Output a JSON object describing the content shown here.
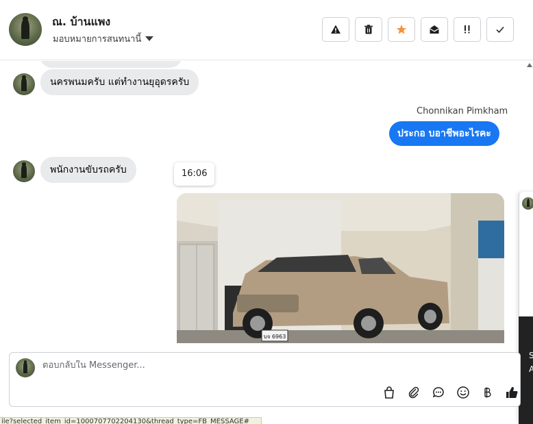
{
  "header": {
    "contact_name": "ณ. บ้านแพง",
    "assign_label": "มอบหมายการสนทนานี้",
    "accent_color": "#f7923a",
    "toolbar": [
      {
        "name": "report-spam-button",
        "icon": "warning-icon"
      },
      {
        "name": "delete-button",
        "icon": "trash-icon"
      },
      {
        "name": "star-button",
        "icon": "star-icon"
      },
      {
        "name": "mark-unread-button",
        "icon": "envelope-open-icon"
      },
      {
        "name": "follow-up-button",
        "icon": "exclaim-icon"
      },
      {
        "name": "mark-done-button",
        "icon": "check-icon"
      }
    ]
  },
  "thread": {
    "msg_1": "นครพนมครับ แต่ทำงานยุอุดรครับ",
    "agent_name": "Chonnikan Pimkham",
    "msg_2": "ประกอ บอาชีพอะไรคะ",
    "msg_3": "พนักงานขับรถครับ",
    "timestamp": "16:06",
    "photo": {
      "plate": "บจ 6963",
      "description": "pickup-truck-photo"
    }
  },
  "composer": {
    "placeholder": "ตอบกลับใน Messenger...",
    "icons": [
      "shopping-bag-icon",
      "attachment-icon",
      "saved-reply-icon",
      "emoji-icon",
      "baht-payment-icon",
      "like-icon"
    ]
  },
  "side_panel": {
    "line1": "S",
    "line2": "A"
  },
  "status_bar": "ile?selected_item_id=1000707702204130&thread_type=FB_MESSAGE#"
}
